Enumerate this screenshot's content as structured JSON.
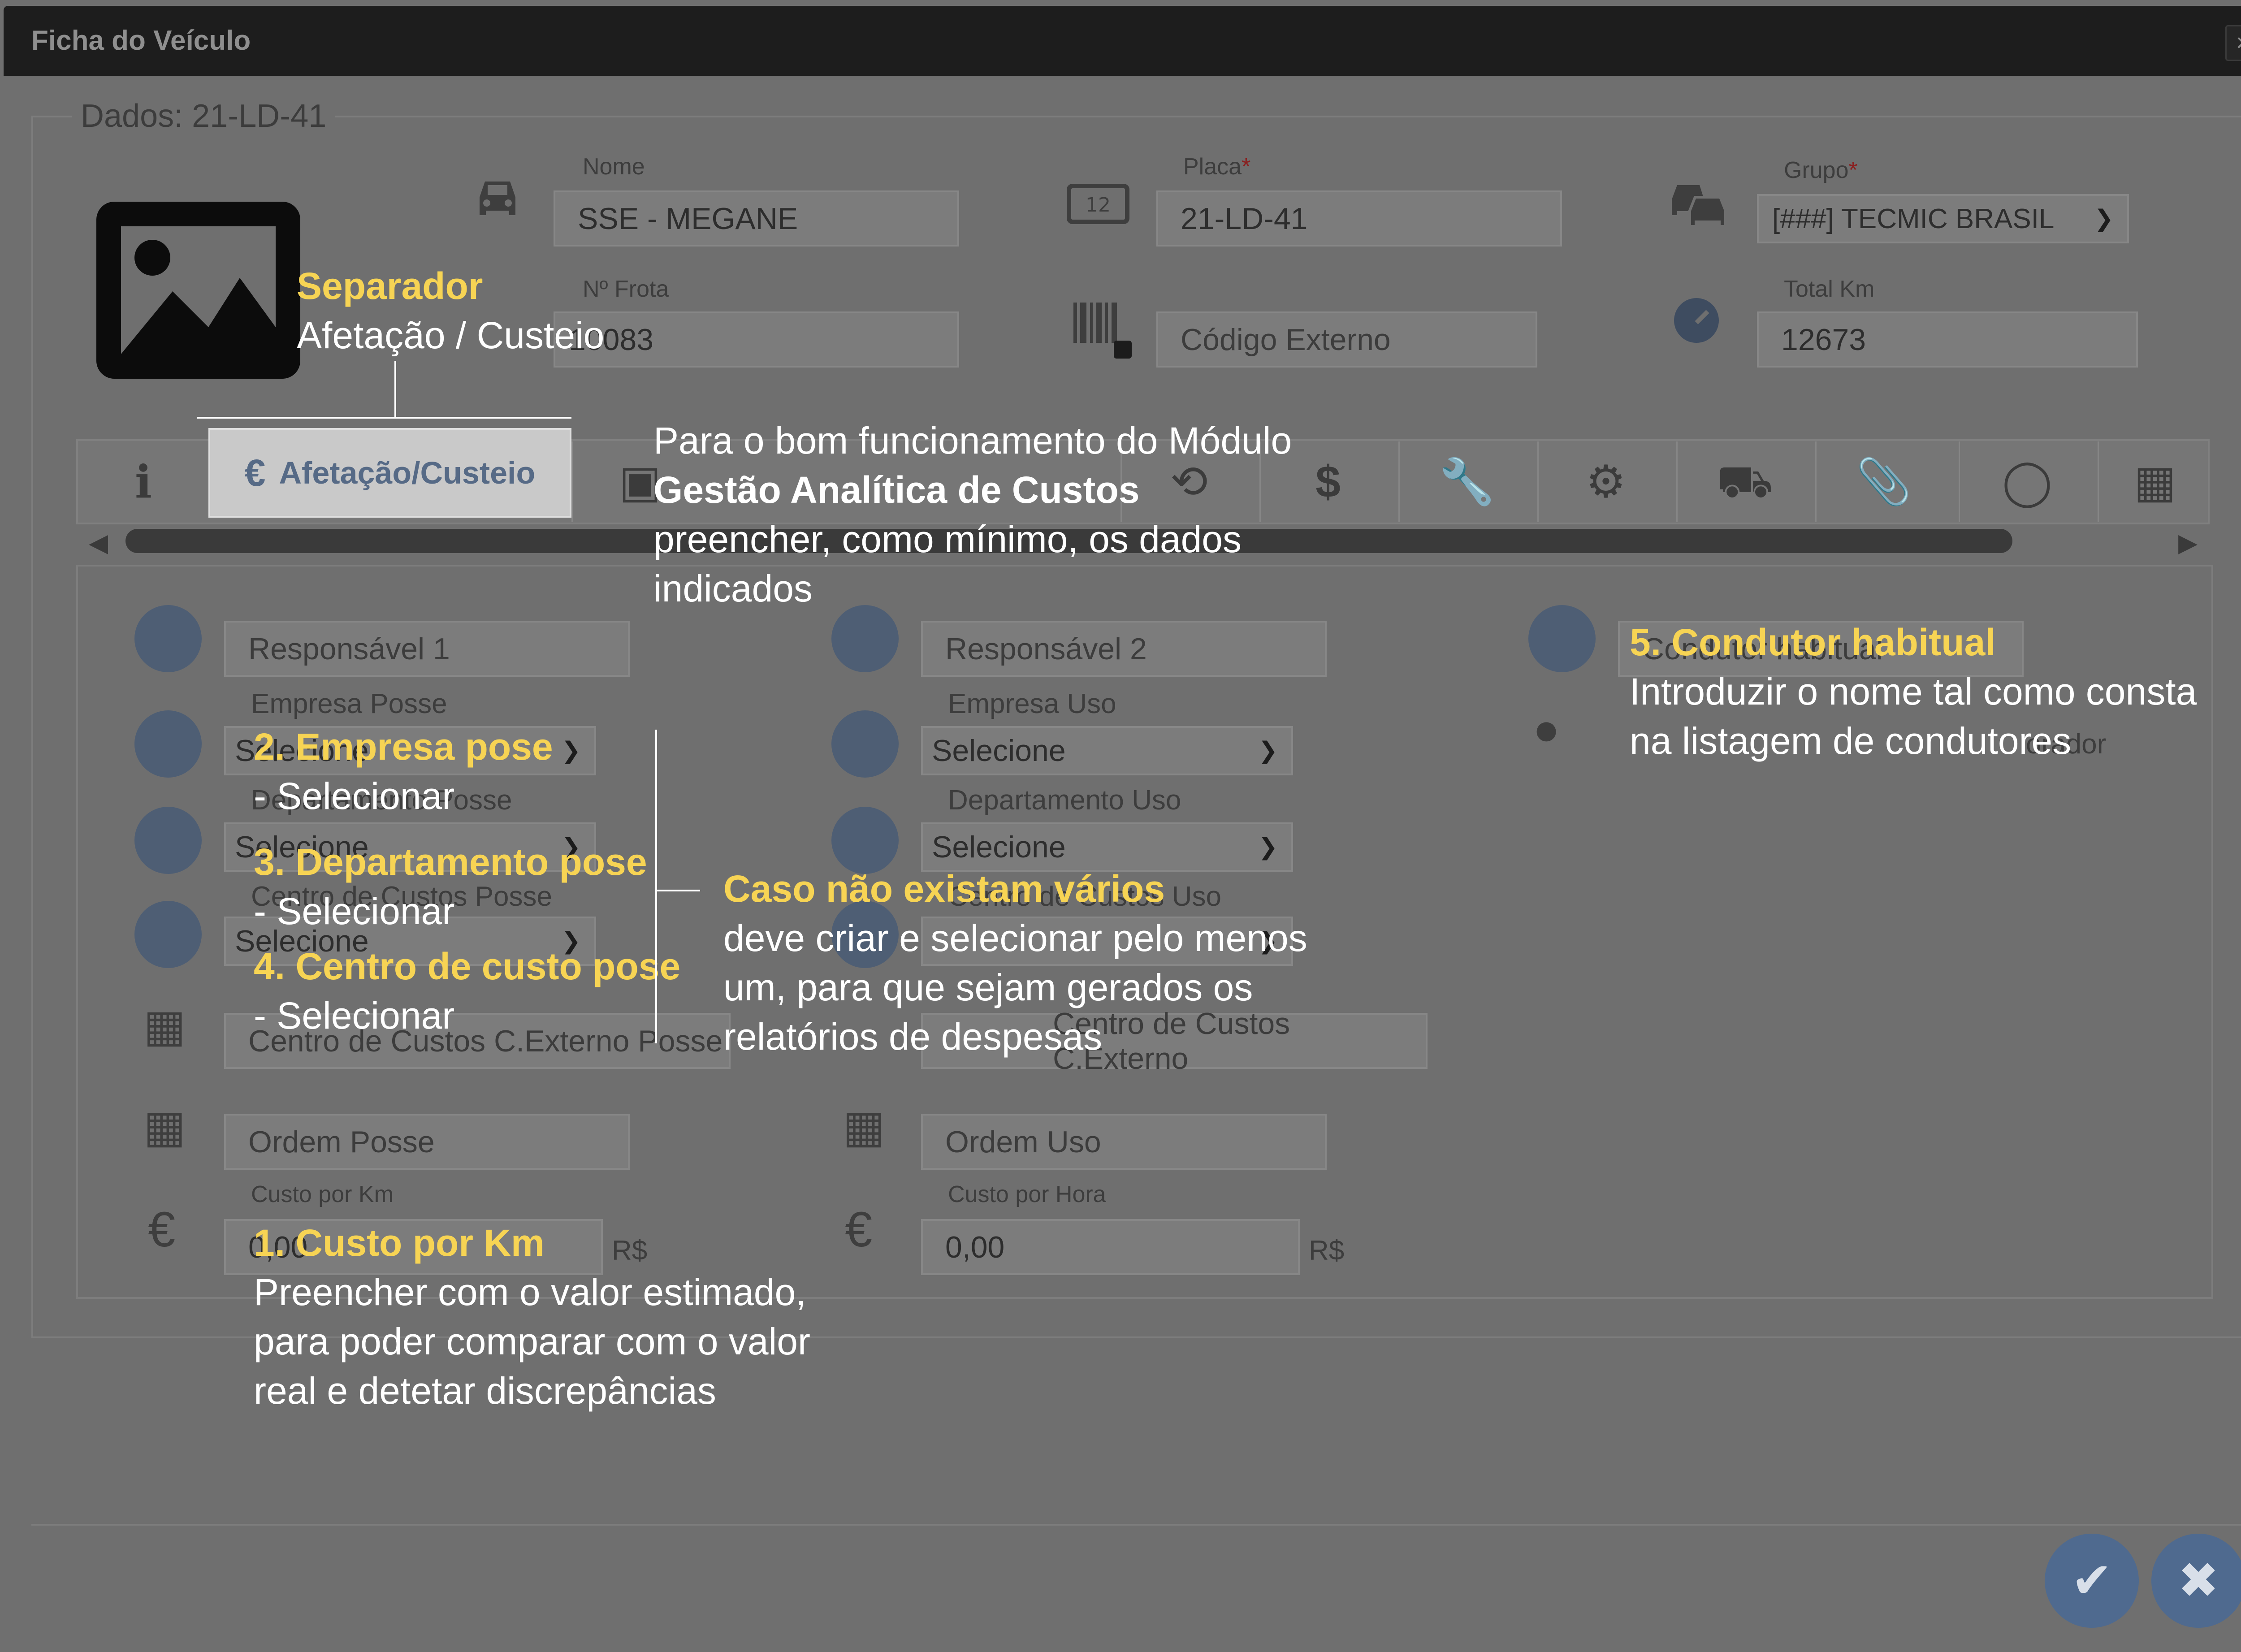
{
  "window": {
    "title": "Ficha do Veículo",
    "close_icon": "×"
  },
  "form": {
    "legend": "Dados: 21-LD-41",
    "nome": {
      "label": "Nome",
      "value": "SSE - MEGANE"
    },
    "placa": {
      "label": "Placa",
      "required_mark": "*",
      "value": "21-LD-41"
    },
    "grupo": {
      "label": "Grupo",
      "required_mark": "*",
      "value": "[###] TECMIC BRASIL"
    },
    "frota": {
      "label": "Nº Frota",
      "value": "10083"
    },
    "codigo_externo": {
      "placeholder": "Código Externo"
    },
    "total_km": {
      "label": "Total Km",
      "value": "12673"
    }
  },
  "tabs": {
    "active_label": "Afetação/Custeio",
    "icons": [
      "info-icon",
      "book-icon",
      "history-icon",
      "dollar-icon",
      "wrench-icon",
      "gear-icon",
      "car-icon",
      "paperclip-icon",
      "toggle-icon",
      "map-icon"
    ]
  },
  "panel": {
    "responsavel1": "Responsável 1",
    "responsavel2": "Responsável 2",
    "empresa_posse_label": "Empresa Posse",
    "empresa_uso_label": "Empresa Uso",
    "departamento_posse_label": "Departamento Posse",
    "departamento_uso_label": "Departamento Uso",
    "centro_custos_posse_label": "Centro de Custos Posse",
    "centro_custos_uso_label": "Centro de Custos Uso",
    "select_default": "Selecione",
    "centro_externo_posse": "Centro de Custos C.Externo Posse",
    "centro_externo_uso": "Centro de Custos C.Externo",
    "ordem_posse": "Ordem Posse",
    "ordem_uso": "Ordem Uso",
    "custo_km_label": "Custo por Km",
    "custo_hora_label": "Custo por Hora",
    "custo_km_value": "0,00",
    "custo_hora_value": "0,00",
    "currency": "R$",
    "condutor_field": "Condutor habitual",
    "condutor_select_tail": "orador"
  },
  "footer": {
    "confirm_icon": "✔",
    "cancel_icon": "✖"
  },
  "annotations": {
    "separador_title": "Separador",
    "separador_sub": "Afetação / Custeio",
    "modulo_line1": "Para o bom funcionamento do Módulo",
    "modulo_line2": "Gestão Analítica de Custos",
    "modulo_line3": "preencher, como mínimo, os dados",
    "modulo_line4": "indicados",
    "a2_title": "2. Empresa pose",
    "a2_sub": "- Selecionar",
    "a3_title": "3. Departamento pose",
    "a3_sub": "- Selecionar",
    "a4_title": "4. Centro de custo pose",
    "a4_sub": "- Selecionar",
    "caso_title": "Caso não existam vários",
    "caso_line1": "deve criar e selecionar pelo menos",
    "caso_line2": "um, para que sejam gerados os",
    "caso_line3": "relatórios de despesas",
    "a5_title": "5. Condutor habitual",
    "a5_line1": " Introduzir o nome tal como consta",
    "a5_line2": "na listagem de condutores",
    "a1_title": "1. Custo por Km",
    "a1_line1": "Preencher com o valor estimado,",
    "a1_line2": "para poder comparar com o valor",
    "a1_line3": "real e detetar discrepâncias"
  }
}
